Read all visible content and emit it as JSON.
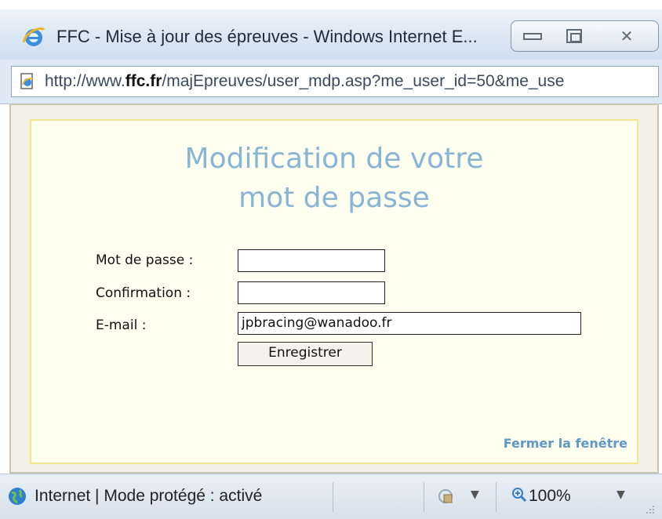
{
  "window": {
    "title": "FFC - Mise à jour des épreuves - Windows Internet E...",
    "buttons": {
      "minimize": "minimize",
      "maximize": "maximize",
      "close": "close"
    }
  },
  "address_bar": {
    "url_prefix": "http://www.",
    "url_domain": "ffc.fr",
    "url_rest": "/majEpreuves/user_mdp.asp?me_user_id=50&me_use"
  },
  "page": {
    "title_line1": "Modification de votre",
    "title_line2": "mot de passe",
    "form": {
      "password_label": "Mot de passe :",
      "password_value": "",
      "confirm_label": "Confirmation :",
      "confirm_value": "",
      "email_label": "E-mail :",
      "email_value": "jpbracing@wanadoo.fr",
      "submit_label": "Enregistrer"
    },
    "close_link": "Fermer la fenêtre"
  },
  "status_bar": {
    "zone_text": "Internet | Mode protégé : activé",
    "zoom": "100%"
  },
  "colors": {
    "title_blue": "#88b4d6",
    "link_blue": "#5f97c8",
    "panel_bg": "#fffff0",
    "panel_border": "#f1e68a"
  },
  "icons": [
    "ie-logo-icon",
    "page-icon",
    "globe-icon",
    "security-icon",
    "zoom-icon",
    "minimize-icon",
    "maximize-icon",
    "close-icon"
  ]
}
